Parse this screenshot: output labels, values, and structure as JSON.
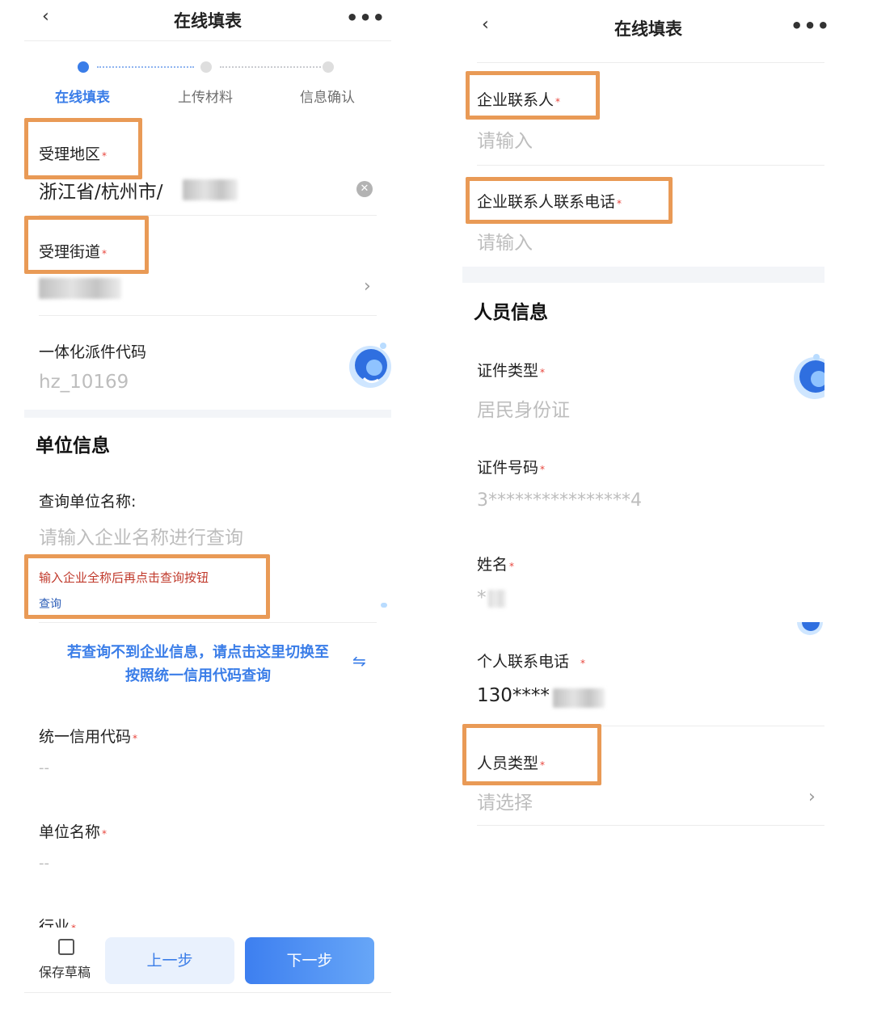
{
  "left": {
    "nav": {
      "title": "在线填表",
      "back": "‹",
      "more": "•••"
    },
    "steps": [
      "在线填表",
      "上传材料",
      "信息确认"
    ],
    "fields": {
      "region": {
        "label": "受理地区",
        "value": "浙江省/杭州市/"
      },
      "street": {
        "label": "受理街道"
      },
      "dispatch_code": {
        "label": "一体化派件代码",
        "value": "hz_10169"
      }
    },
    "unit_section": {
      "title": "单位信息",
      "query_label": "查询单位名称:",
      "query_placeholder": "请输入企业名称进行查询",
      "hint": "输入企业全称后再点击查询按钮",
      "query_link": "查询",
      "switch_line1": "若查询不到企业信息，请点击这里切换至",
      "switch_line2": "按照统一信用代码查询",
      "credit_code": {
        "label": "统一信用代码",
        "value": "--"
      },
      "unit_name": {
        "label": "单位名称",
        "value": "--"
      },
      "industry": {
        "label": "行业"
      }
    },
    "footer": {
      "draft": "保存草稿",
      "prev": "上一步",
      "next": "下一步"
    }
  },
  "right": {
    "nav": {
      "title": "在线填表",
      "back": "‹",
      "more": "•••"
    },
    "contact": {
      "label": "企业联系人",
      "placeholder": "请输入"
    },
    "contact_phone": {
      "label": "企业联系人联系电话",
      "placeholder": "请输入"
    },
    "person_section": {
      "title": "人员信息",
      "id_type": {
        "label": "证件类型",
        "value": "居民身份证"
      },
      "id_number": {
        "label": "证件号码",
        "value": "3****************4"
      },
      "name": {
        "label": "姓名",
        "value": "*"
      },
      "phone": {
        "label": "个人联系电话",
        "value": "130****"
      },
      "person_type": {
        "label": "人员类型",
        "placeholder": "请选择"
      }
    }
  },
  "required_mark": "*",
  "colors": {
    "accent": "#3a7de8",
    "highlight": "#e99a56",
    "required": "#e8453c",
    "hint": "#c0392b"
  }
}
